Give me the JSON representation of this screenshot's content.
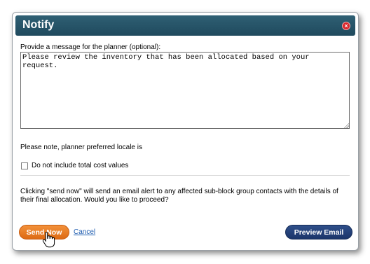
{
  "dialog": {
    "title": "Notify",
    "close_glyph": "×",
    "message_label": "Provide a message for the planner (optional):",
    "message_value": "Please review the inventory that has been allocated based on your\nrequest.",
    "locale_note": "Please note, planner preferred locale is",
    "checkbox_label": "Do not include total cost values",
    "checkbox_checked": false,
    "info_text": "Clicking \"send now\" will send an email alert to any affected sub-block group contacts with the details of their final allocation. Would you like to proceed?",
    "buttons": {
      "send_now": "Send Now",
      "cancel": "Cancel",
      "preview_email": "Preview Email"
    }
  },
  "colors": {
    "titlebar": "#1f4a5e",
    "close": "#d9262b",
    "send_button": "#e8781f",
    "preview_button": "#1b356a",
    "link": "#1f5db0"
  },
  "icons": {
    "close": "close-icon",
    "cursor": "hand-pointer-icon",
    "resize": "resize-grip-icon"
  }
}
